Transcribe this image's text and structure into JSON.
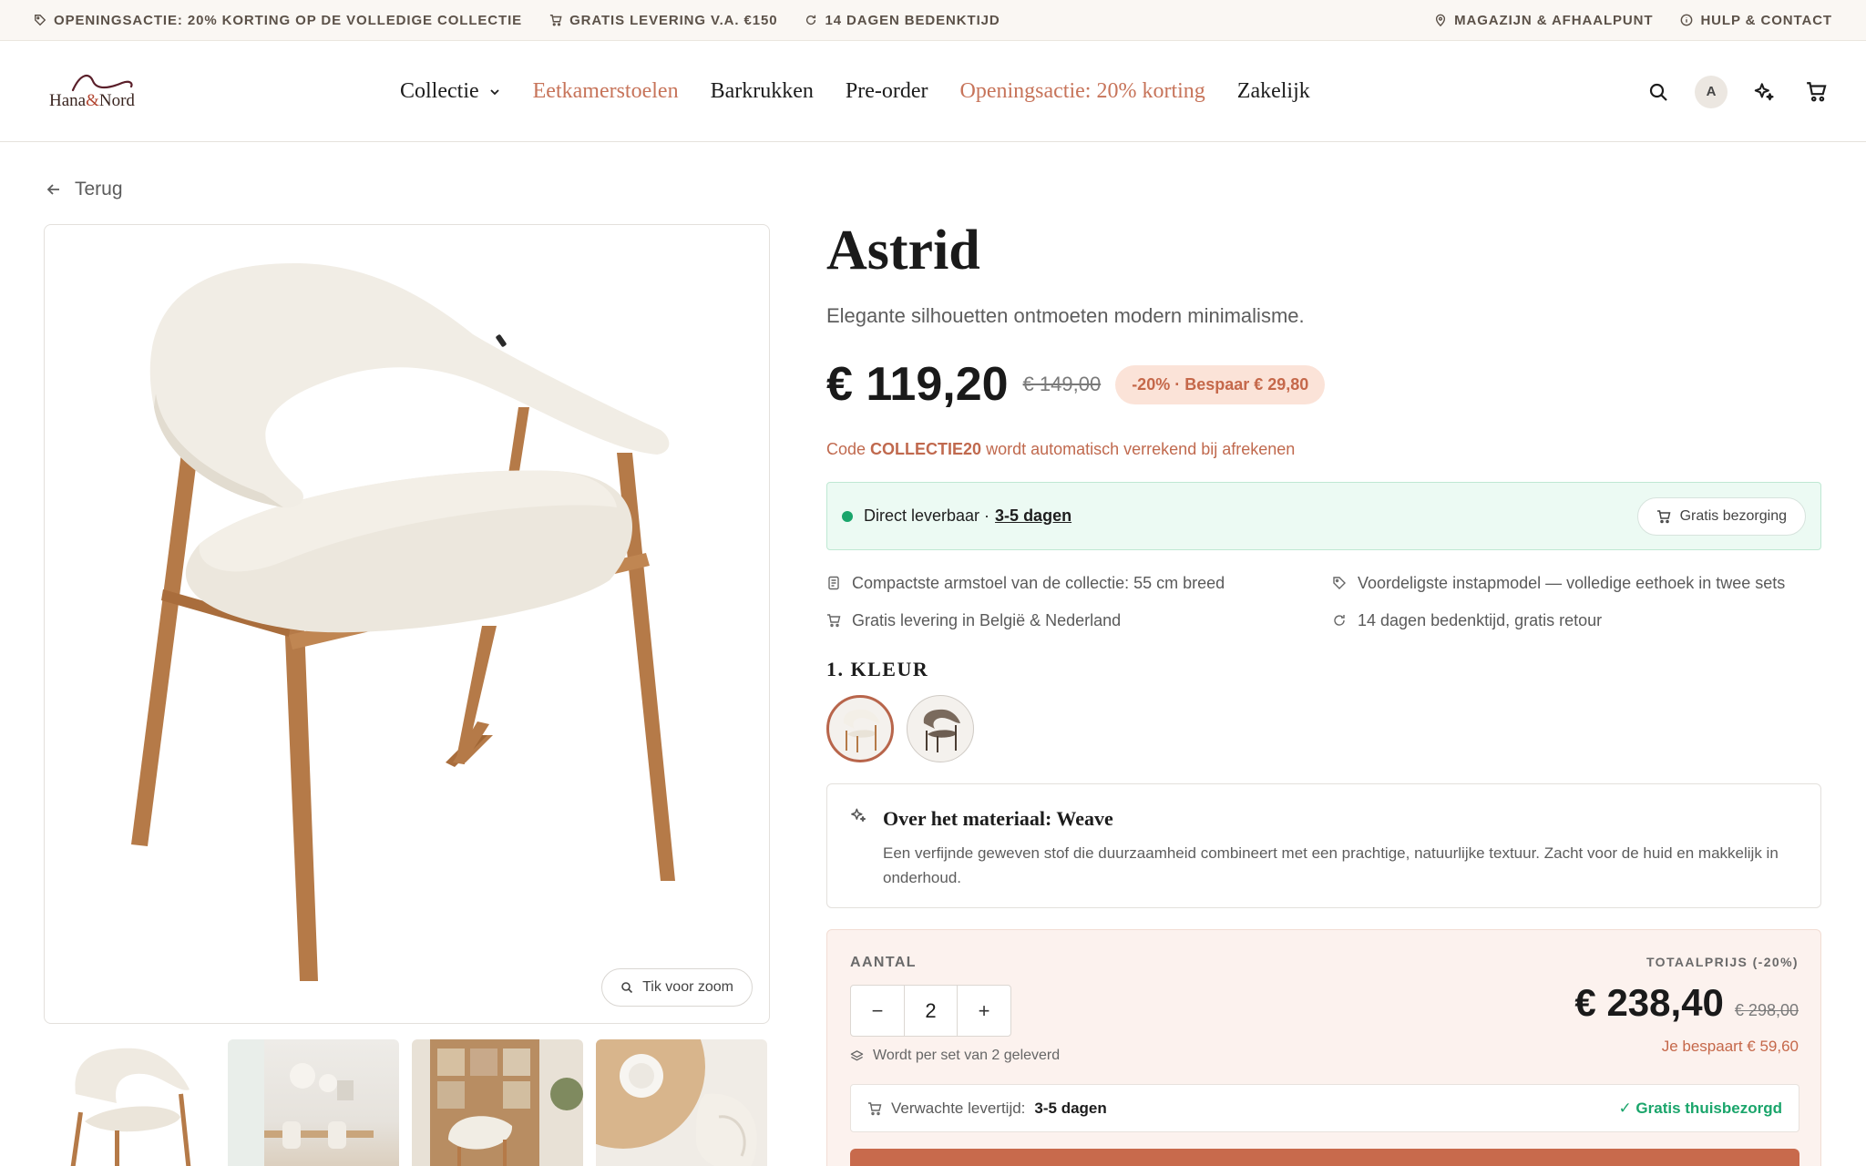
{
  "topbar": {
    "promo": "OPENINGSACTIE: 20% KORTING OP DE VOLLEDIGE COLLECTIE",
    "delivery": "GRATIS LEVERING V.A. €150",
    "returns": "14 DAGEN BEDENKTIJD",
    "store": "MAGAZIJN & AFHAALPUNT",
    "help": "HULP & CONTACT"
  },
  "header": {
    "logo_text_1": "Hana",
    "logo_amp": "&",
    "logo_text_2": "Nord",
    "nav": {
      "collectie": "Collectie",
      "eetkamerstoelen": "Eetkamerstoelen",
      "barkrukken": "Barkrukken",
      "preorder": "Pre-order",
      "openingsactie": "Openingsactie: 20% korting",
      "zakelijk": "Zakelijk"
    },
    "avatar_initial": "A",
    "accent_color": "#c7745a"
  },
  "back_label": "Terug",
  "gallery": {
    "zoom_label": "Tik voor zoom"
  },
  "product": {
    "name": "Astrid",
    "tagline": "Elegante silhouetten ontmoeten modern minimalisme.",
    "price": "€ 119,20",
    "old_price": "€ 149,00",
    "discount_badge": "-20% · Bespaar € 29,80",
    "code_prefix": "Code",
    "code": "COLLECTIE20",
    "code_suffix": "wordt automatisch verrekend bij afrekenen"
  },
  "stock": {
    "status": "Direct leverbaar ·",
    "days": "3-5 dagen",
    "free_delivery": "Gratis bezorging"
  },
  "features": {
    "f1": "Compactste armstoel van de collectie: 55 cm breed",
    "f2": "Voordeligste instapmodel — volledige eethoek in twee sets",
    "f3": "Gratis levering in België & Nederland",
    "f4": "14 dagen bedenktijd, gratis retour"
  },
  "color_section": {
    "heading": "1. KLEUR",
    "options": [
      "Weave beige",
      "Taupe"
    ]
  },
  "material": {
    "title": "Over het materiaal: Weave",
    "description": "Een verfijnde geweven stof die duurzaamheid combineert met een prachtige, natuurlijke textuur. Zacht voor de huid en makkelijk in onderhoud."
  },
  "order": {
    "qty_label": "AANTAL",
    "minus": "−",
    "quantity": "2",
    "plus": "+",
    "set_note": "Wordt per set van 2 geleverd",
    "total_label": "TOTAALPRIJS (-20%)",
    "total_price": "€ 238,40",
    "total_old": "€ 298,00",
    "savings": "Je bespaart € 59,60",
    "delivery_label": "Verwachte levertijd:",
    "delivery_days": "3-5 dagen",
    "delivery_free": "✓ Gratis thuisbezorgd",
    "cta_color": "#c86a4c"
  }
}
